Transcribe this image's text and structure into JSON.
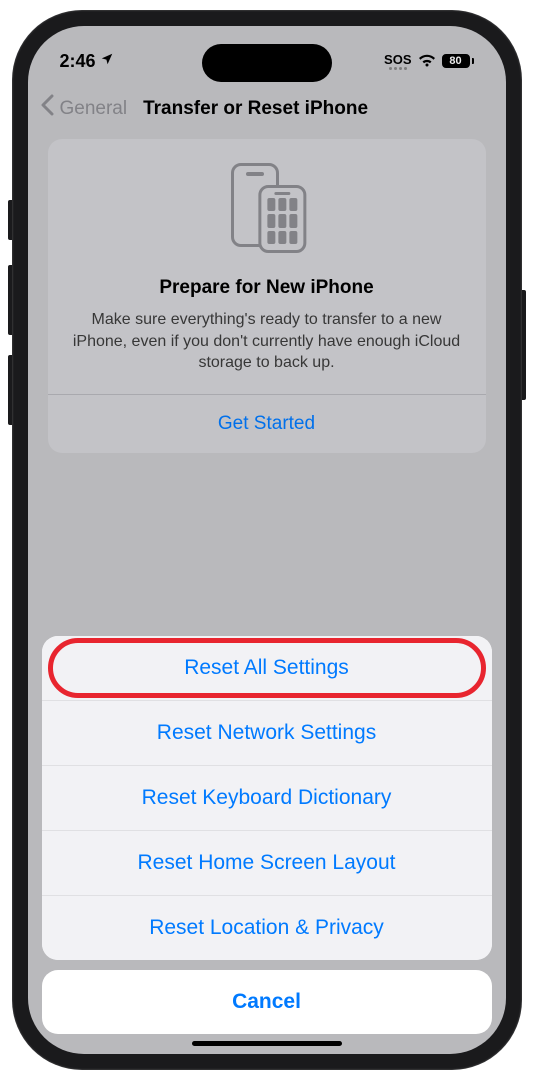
{
  "status_bar": {
    "time": "2:46",
    "sos": "SOS",
    "battery": "80"
  },
  "nav": {
    "back_label": "General",
    "title": "Transfer or Reset iPhone"
  },
  "prepare_card": {
    "title": "Prepare for New iPhone",
    "description": "Make sure everything's ready to transfer to a new iPhone, even if you don't currently have enough iCloud storage to back up.",
    "action": "Get Started"
  },
  "reset_label_partial": "Reset",
  "action_sheet": {
    "options": [
      "Reset All Settings",
      "Reset Network Settings",
      "Reset Keyboard Dictionary",
      "Reset Home Screen Layout",
      "Reset Location & Privacy"
    ],
    "cancel": "Cancel"
  }
}
